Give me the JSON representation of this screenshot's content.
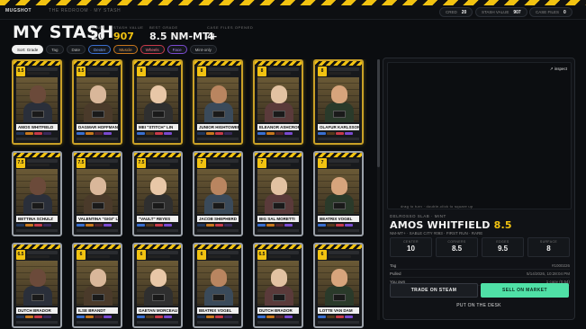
{
  "topbar": {
    "brand": "MUGSHOT",
    "breadcrumb": "THE REDROOM · MY STASH",
    "pills": [
      {
        "label": "CRED",
        "value": "20"
      },
      {
        "label": "STASH VALUE",
        "value": "907"
      },
      {
        "label": "CASE FILES",
        "value": "0"
      }
    ]
  },
  "page": {
    "title": "MY STASH",
    "stats": [
      {
        "label": "SLABS",
        "value": "20"
      },
      {
        "label": "STASH VALUE",
        "value": "907"
      },
      {
        "label": "BEST GRADE",
        "value": "8.5 NM-MT+"
      },
      {
        "label": "CASE FILES OPENED",
        "value": "4"
      }
    ]
  },
  "filters": [
    "Sort: Grade",
    "Tag",
    "Date",
    "Dexter",
    "Muscle",
    "Wheels",
    "Face",
    "Mint-only"
  ],
  "cards": [
    {
      "grade": "8.5",
      "name": "AMOS WHITFIELD",
      "frame": "gold"
    },
    {
      "grade": "8.5",
      "name": "DAGMAR HOFFMANN",
      "frame": "gold"
    },
    {
      "grade": "8",
      "name": "MEI \"STITCH\" LIN",
      "frame": "gold"
    },
    {
      "grade": "8",
      "name": "JUNIOR HIGHTOWER",
      "frame": "gold"
    },
    {
      "grade": "8",
      "name": "ELEANOR ASHCROFT",
      "frame": "gold"
    },
    {
      "grade": "8",
      "name": "OLAFUR KARLSSON",
      "frame": "gold"
    },
    {
      "grade": "7.5",
      "name": "BETTINA SCHULZ",
      "frame": "silver"
    },
    {
      "grade": "7.5",
      "name": "VALENTINA \"GIGI\" LOCA",
      "frame": "silver"
    },
    {
      "grade": "7.5",
      "name": "\"VAULT\" REYES",
      "frame": "silver"
    },
    {
      "grade": "7",
      "name": "JACOB SHEPHERD",
      "frame": "silver"
    },
    {
      "grade": "7",
      "name": "BIG SAL MORETTI",
      "frame": "silver"
    },
    {
      "grade": "7",
      "name": "BEATRIX VOGEL",
      "frame": "silver"
    },
    {
      "grade": "6.5",
      "name": "DUTCH BRADOR",
      "frame": "silver"
    },
    {
      "grade": "6",
      "name": "ILSE BRANDT",
      "frame": "silver"
    },
    {
      "grade": "6",
      "name": "GAETAN MORCEAU",
      "frame": "silver"
    },
    {
      "grade": "6",
      "name": "BEATRIX VOGEL",
      "frame": "silver"
    },
    {
      "grade": "6.5",
      "name": "DUTCH BRADOR",
      "frame": "silver"
    },
    {
      "grade": "6",
      "name": "LOTTE VAN DAM",
      "frame": "silver"
    }
  ],
  "detail": {
    "inspect_label": "↗ inspect",
    "hint": "drag to turn · double-click to square up",
    "series": "DELROSSO SLAB · MINT",
    "name": "AMOS WHITFIELD",
    "grade": "8.5",
    "sub": "NM-MT+ · SABLE CITY #093 · FIRST RUN · RARE",
    "subgrades": [
      {
        "label": "CENTER",
        "value": "10"
      },
      {
        "label": "CORNERS",
        "value": "8.5"
      },
      {
        "label": "EDGES",
        "value": "9.5"
      },
      {
        "label": "SURFACE",
        "value": "8"
      }
    ],
    "rows": [
      {
        "key": "Tag",
        "value": "#1000226"
      },
      {
        "key": "Pulled",
        "value": "5/14/2026, 10:28:04 PM"
      },
      {
        "key": "You own",
        "value": "1 copy (0.54)"
      }
    ],
    "trade_label": "TRADE ON STEAM",
    "sell_label": "SELL ON MARKET",
    "desk_label": "PUT ON THE DESK"
  }
}
